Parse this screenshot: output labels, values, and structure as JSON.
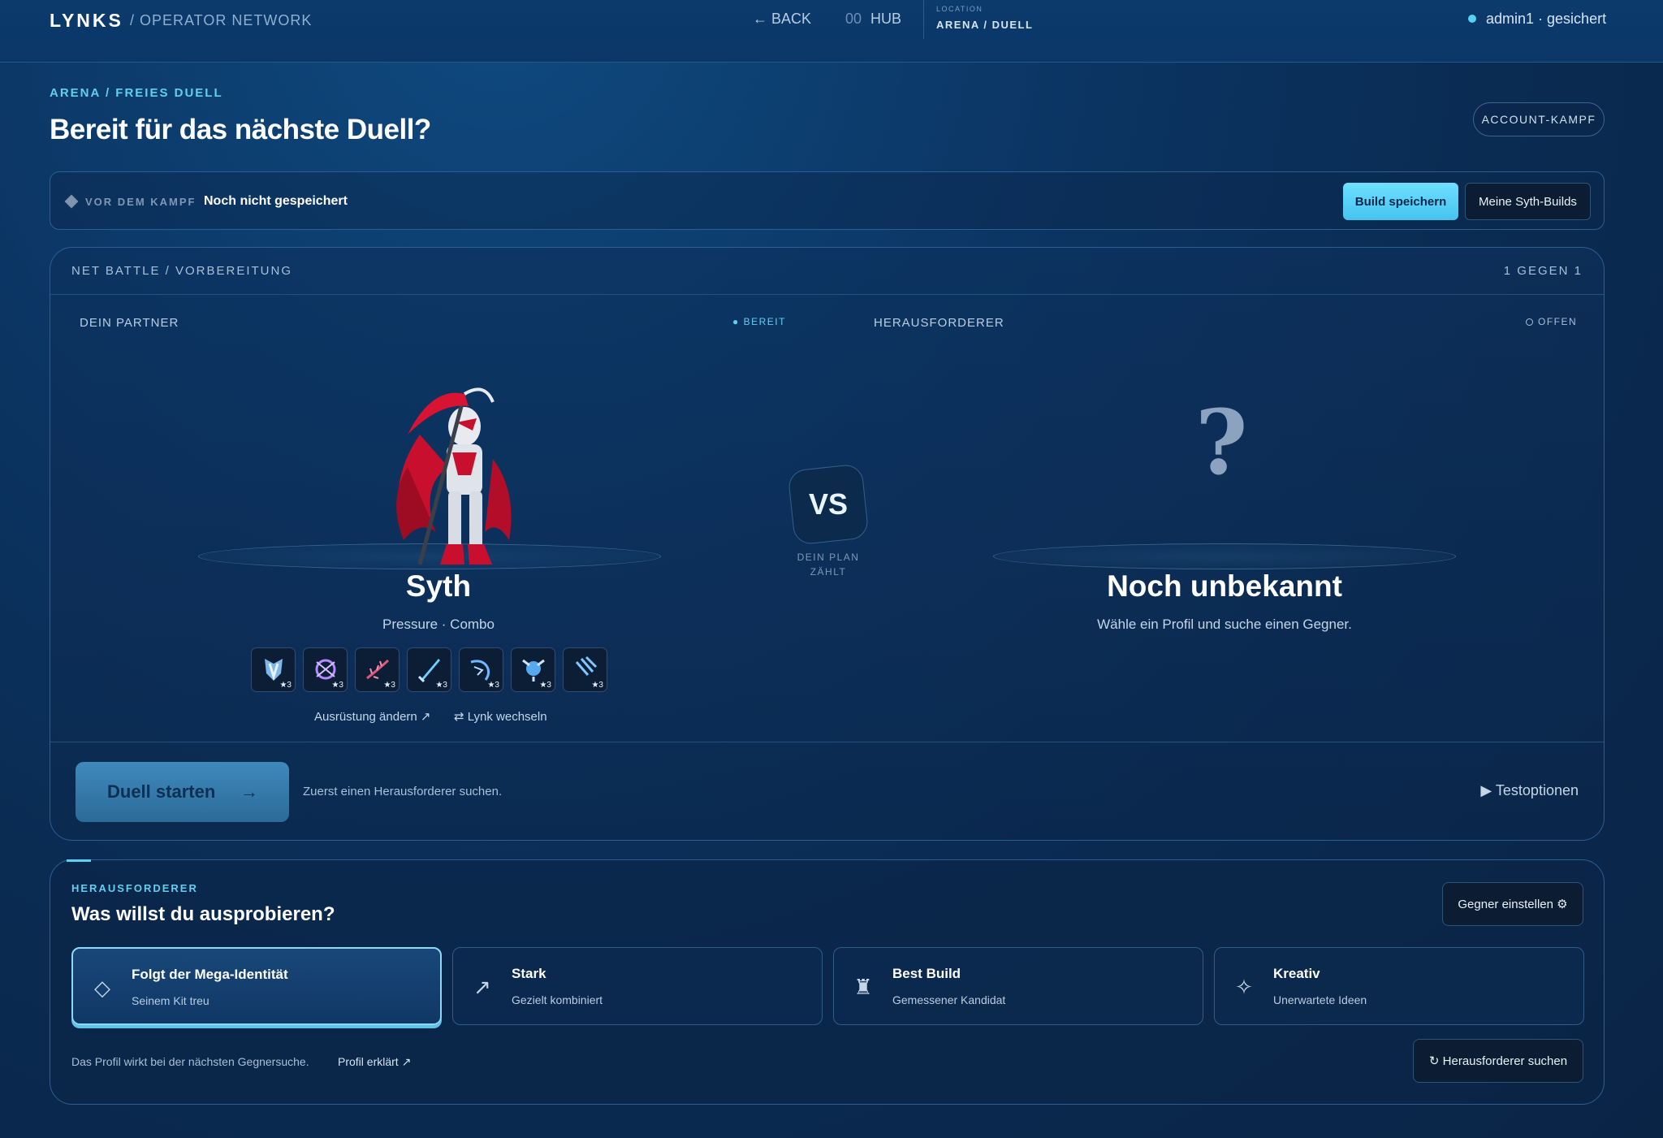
{
  "topbar": {
    "logo": "LYNKS",
    "subtitle": "/ OPERATOR NETWORK",
    "back": "← BACK",
    "hub_num": "00",
    "hub": "HUB",
    "location_label": "LOCATION",
    "location_value": "ARENA / DUELL",
    "user_status": "admin1 · gesichert"
  },
  "page": {
    "breadcrumb": "ARENA / FREIES DUELL",
    "title": "Bereit für das nächste Duell?",
    "account_button": "ACCOUNT-KAMPF"
  },
  "prebar": {
    "label": "VOR DEM KAMPF",
    "value": "Noch nicht gespeichert",
    "save_button": "Build speichern",
    "builds_button": "Meine Syth-Builds"
  },
  "battle": {
    "header_left": "NET BATTLE / VORBEREITUNG",
    "header_right": "1 GEGEN 1",
    "partner_label": "DEIN PARTNER",
    "ready": "● BEREIT",
    "challenger_label": "HERAUSFORDERER",
    "open": "OFFEN",
    "partner": {
      "name": "Syth",
      "subtitle": "Pressure · Combo",
      "chips": [
        {
          "icon": "shield-claw-icon",
          "stars": "★3"
        },
        {
          "icon": "purple-burst-icon",
          "stars": "★3"
        },
        {
          "icon": "thorn-vine-icon",
          "stars": "★3"
        },
        {
          "icon": "blade-icon",
          "stars": "★3"
        },
        {
          "icon": "dragon-icon",
          "stars": "★3"
        },
        {
          "icon": "orb-icon",
          "stars": "★3"
        },
        {
          "icon": "claw-slash-icon",
          "stars": "★3"
        }
      ],
      "equip_link": "Ausrüstung ändern ↗",
      "swap_link": "⇄ Lynk wechseln"
    },
    "vs": "VS",
    "vs_caption": "DEIN PLAN ZÄHLT",
    "challenger": {
      "mark": "?",
      "name": "Noch unbekannt",
      "subtitle": "Wähle ein Profil und suche einen Gegner."
    },
    "start_button": "Duell starten",
    "start_arrow": "→",
    "start_hint": "Zuerst einen Herausforderer suchen.",
    "test_options": "▶ Testoptionen"
  },
  "challenger_panel": {
    "label": "HERAUSFORDERER",
    "title": "Was willst du ausprobieren?",
    "opponent_button": "Gegner einstellen ⚙",
    "cards": [
      {
        "icon": "diamond-icon",
        "glyph": "◇",
        "title": "Folgt der Mega-Identität",
        "sub": "Seinem Kit treu",
        "selected": true
      },
      {
        "icon": "arrow-up-right-icon",
        "glyph": "↗",
        "title": "Stark",
        "sub": "Gezielt kombiniert",
        "selected": false
      },
      {
        "icon": "rook-icon",
        "glyph": "♜",
        "title": "Best Build",
        "sub": "Gemessener Kandidat",
        "selected": false
      },
      {
        "icon": "sparkle-icon",
        "glyph": "✧",
        "title": "Kreativ",
        "sub": "Unerwartete Ideen",
        "selected": false
      }
    ],
    "note": "Das Profil wirkt bei der nächsten Gegnersuche.",
    "note_link": "Profil erklärt ↗",
    "search_button": "↻ Herausforderer suchen"
  },
  "colors": {
    "accent": "#5fd0f0",
    "background": "#0b3563",
    "partner_red": "#c8102e"
  }
}
